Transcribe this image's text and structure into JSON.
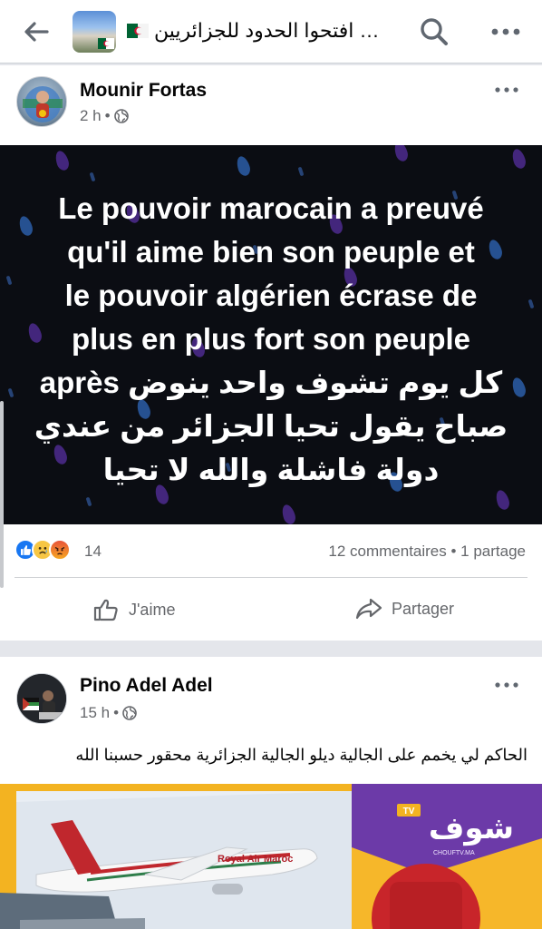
{
  "header": {
    "title": "… افتحوا الحدود للجزائريين",
    "back_icon": "back-arrow-icon",
    "search_icon": "search-icon",
    "more_icon": "more-horizontal-icon"
  },
  "posts": [
    {
      "author": "Mounir Fortas",
      "time": "2 h",
      "privacy_icon": "globe-icon",
      "banner_lines": [
        "Le pouvoir marocain a preuvé",
        "qu'il aime bien son peuple et",
        "le pouvoir algérien écrase de",
        "plus en plus fort son peuple"
      ],
      "banner_arabic_lines": [
        "كل يوم تشوف واحد ينوض après",
        "صباح يقول تحيا الجزائر من عندي",
        "دولة فاشلة والله لا تحيا"
      ],
      "banner_colors": {
        "background": "#0b0d13",
        "drops": "#4d2c8f"
      },
      "reaction_icons": [
        "like-reaction-icon",
        "sad-reaction-icon",
        "angry-reaction-icon"
      ],
      "reaction_count": "14",
      "comments_shares": "12 commentaires • 1 partage",
      "like_label": "J'aime",
      "share_label": "Partager"
    },
    {
      "author": "Pino Adel Adel",
      "time": "15 h",
      "privacy_icon": "globe-icon",
      "text": "الحاكم لي يخمم على الجالية ديلو الجالية الجزائرية محقور حسبنا الله",
      "image_texts": {
        "airline": "Royal Air Maroc",
        "channel": "شوف",
        "channel_tv": "TV",
        "channel_url": "CHOUFTV.MA"
      }
    }
  ],
  "colors": {
    "accent": "#1877f2",
    "secondary_text": "#65676b",
    "divider": "#ced0d4"
  }
}
